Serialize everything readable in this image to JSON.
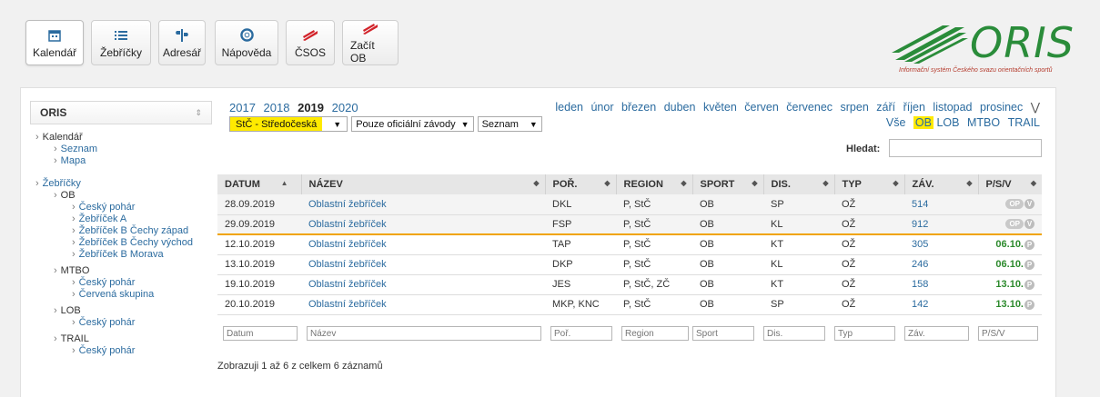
{
  "toolbar": {
    "buttons": [
      {
        "label": "Kalendář",
        "icon": "calendar-icon"
      },
      {
        "label": "Žebříčky",
        "icon": "list-icon"
      },
      {
        "label": "Adresář",
        "icon": "signpost-icon"
      },
      {
        "label": "Nápověda",
        "icon": "lifebuoy-icon"
      },
      {
        "label": "ČSOS",
        "icon": "csos-logo-icon"
      },
      {
        "label": "Začít OB",
        "icon": "zacit-ob-logo-icon"
      }
    ]
  },
  "logo": {
    "text": "ORIS",
    "tagline": "Informační systém Českého svazu orientačních sportů",
    "color": "#2a8c3a"
  },
  "sidebar": {
    "header": "ORIS",
    "tree": {
      "kalendar": "Kalendář",
      "seznam": "Seznam",
      "mapa": "Mapa",
      "zebricky": "Žebříčky",
      "ob": "OB",
      "ob_items": [
        "Český pohár",
        "Žebříček A",
        "Žebříček B Čechy západ",
        "Žebříček B Čechy východ",
        "Žebříček B Morava"
      ],
      "mtbo": "MTBO",
      "mtbo_items": [
        "Český pohár",
        "Červená skupina"
      ],
      "lob": "LOB",
      "lob_items": [
        "Český pohár"
      ],
      "trail": "TRAIL",
      "trail_items": [
        "Český pohár"
      ]
    }
  },
  "years": {
    "items": [
      "2017",
      "2018",
      "2019",
      "2020"
    ],
    "current": "2019"
  },
  "filters": {
    "region": "StČ - Středočeská",
    "official": "Pouze oficiální závody",
    "view": "Seznam"
  },
  "months": [
    "leden",
    "únor",
    "březen",
    "duben",
    "květen",
    "červen",
    "červenec",
    "srpen",
    "září",
    "říjen",
    "listopad",
    "prosinec"
  ],
  "expand_icon": "double-chevron-down-icon",
  "types": {
    "items": [
      "Vše",
      "OB",
      "LOB",
      "MTBO",
      "TRAIL"
    ],
    "active": "OB"
  },
  "search": {
    "label": "Hledat:",
    "value": ""
  },
  "table": {
    "columns": [
      "DATUM",
      "NÁZEV",
      "POŘ.",
      "REGION",
      "SPORT",
      "DIS.",
      "TYP",
      "ZÁV.",
      "P/S/V"
    ],
    "rows": [
      {
        "datum": "28.09.2019",
        "nazev": "Oblastní žebříček",
        "por": "DKL",
        "region": "P, StČ",
        "sport": "OB",
        "dis": "SP",
        "typ": "OŽ",
        "zav": "514",
        "psv": "",
        "pill": "OP",
        "circ": "V",
        "past": true
      },
      {
        "datum": "29.09.2019",
        "nazev": "Oblastní žebříček",
        "por": "FSP",
        "region": "P, StČ",
        "sport": "OB",
        "dis": "KL",
        "typ": "OŽ",
        "zav": "912",
        "psv": "",
        "pill": "OP",
        "circ": "V",
        "past": true
      },
      {
        "datum": "12.10.2019",
        "nazev": "Oblastní žebříček",
        "por": "TAP",
        "region": "P, StČ",
        "sport": "OB",
        "dis": "KT",
        "typ": "OŽ",
        "zav": "305",
        "psv": "06.10.",
        "pill": "",
        "circ": "P",
        "past": false
      },
      {
        "datum": "13.10.2019",
        "nazev": "Oblastní žebříček",
        "por": "DKP",
        "region": "P, StČ",
        "sport": "OB",
        "dis": "KL",
        "typ": "OŽ",
        "zav": "246",
        "psv": "06.10.",
        "pill": "",
        "circ": "P",
        "past": false
      },
      {
        "datum": "19.10.2019",
        "nazev": "Oblastní žebříček",
        "por": "JES",
        "region": "P, StČ, ZČ",
        "sport": "OB",
        "dis": "KT",
        "typ": "OŽ",
        "zav": "158",
        "psv": "13.10.",
        "pill": "",
        "circ": "P",
        "past": false
      },
      {
        "datum": "20.10.2019",
        "nazev": "Oblastní žebříček",
        "por": "MKP, KNC",
        "region": "P, StČ",
        "sport": "OB",
        "dis": "SP",
        "typ": "OŽ",
        "zav": "142",
        "psv": "13.10.",
        "pill": "",
        "circ": "P",
        "past": false
      }
    ],
    "column_filters": [
      "Datum",
      "Název",
      "Poř.",
      "Region",
      "Sport",
      "Dis.",
      "Typ",
      "Záv.",
      "P/S/V"
    ]
  },
  "info": "Zobrazuji 1 až 6 z celkem 6 záznamů"
}
